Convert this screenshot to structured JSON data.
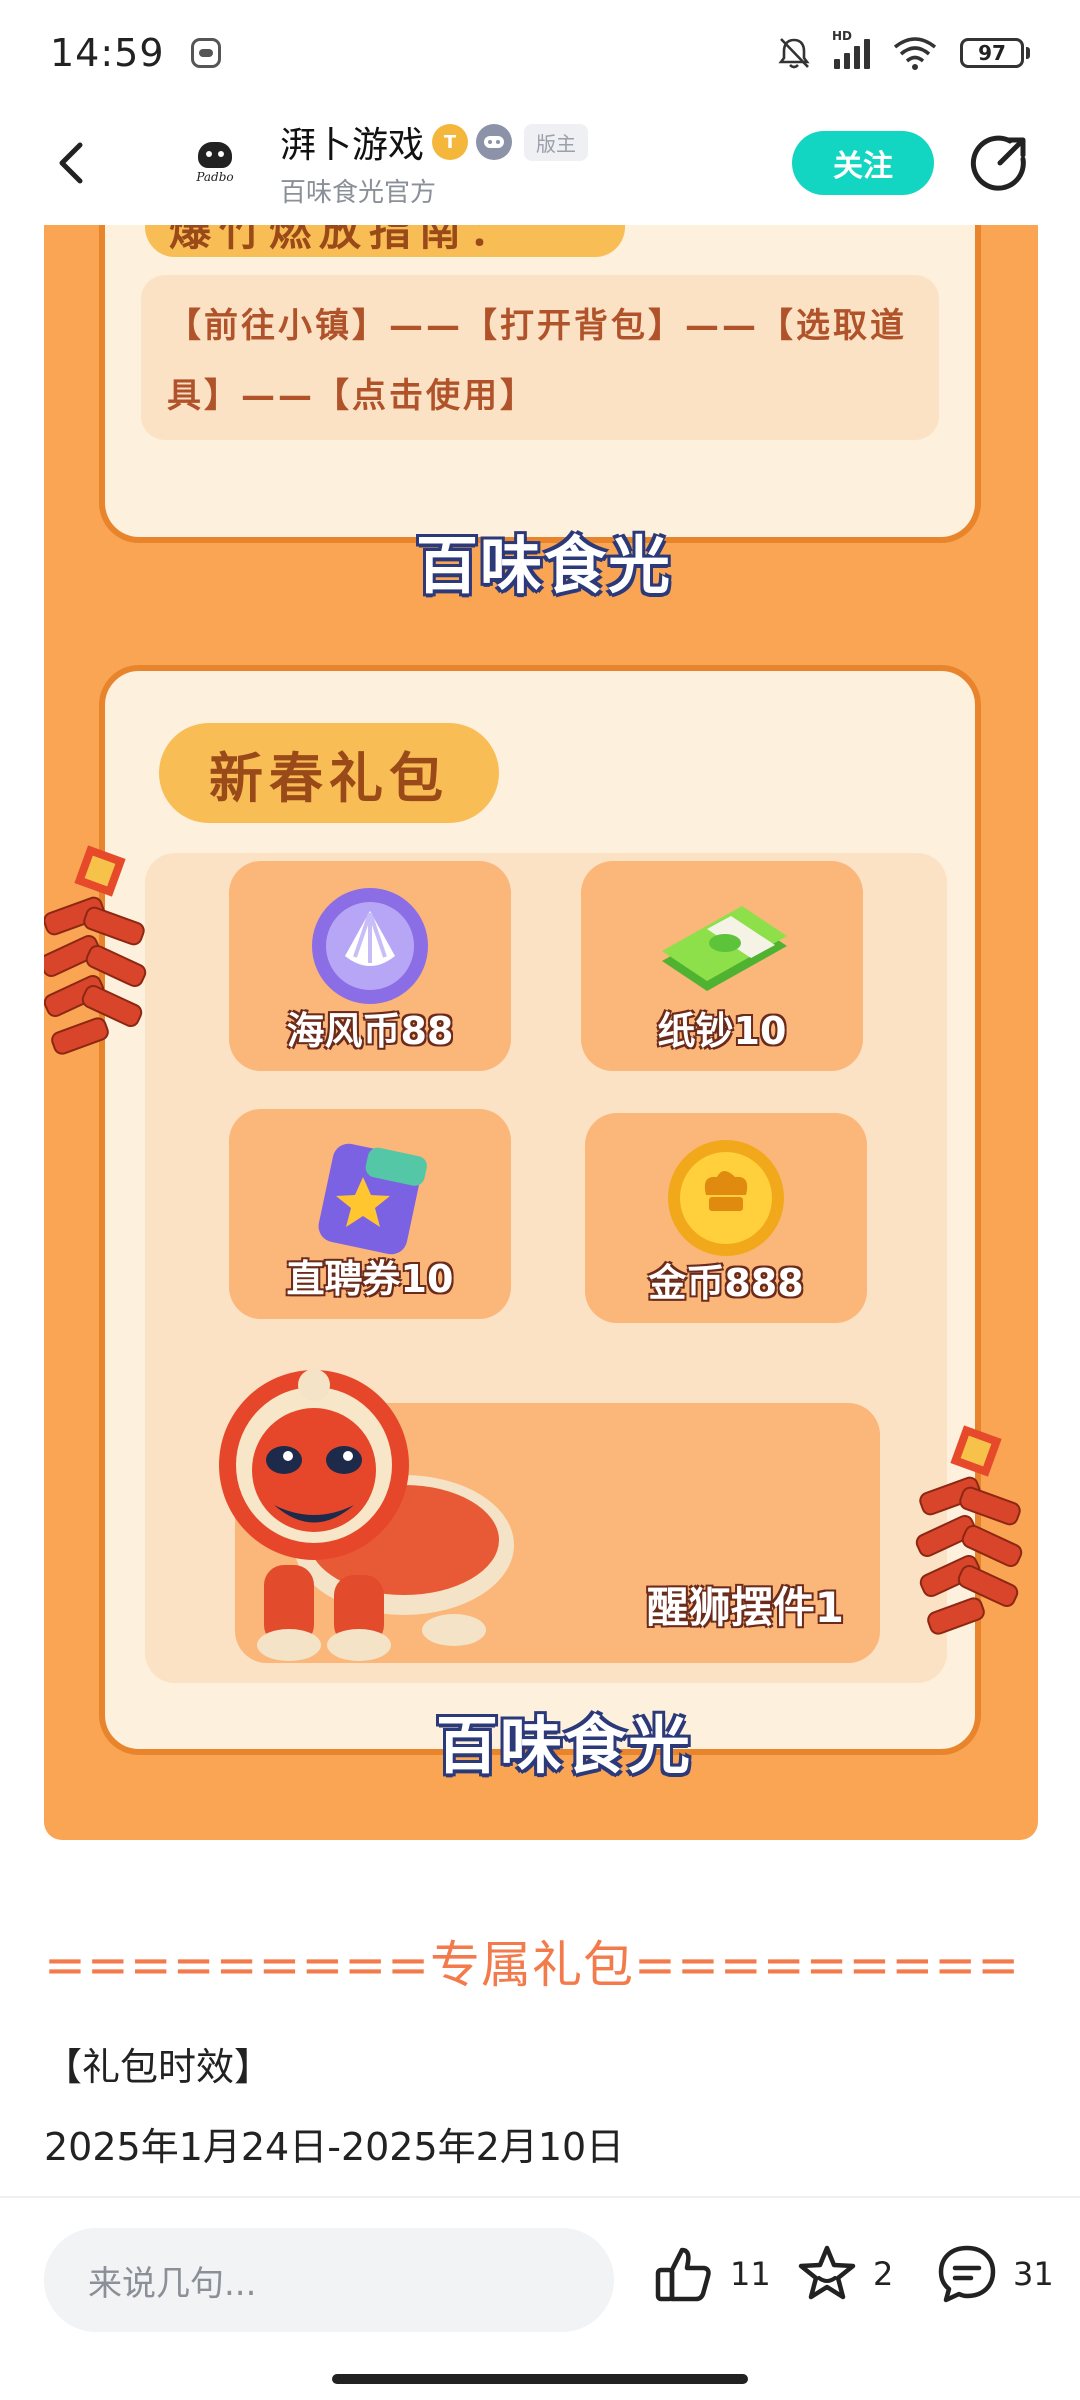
{
  "status_bar": {
    "time": "14:59",
    "battery": "97",
    "network_label": "HD",
    "icons": [
      "app-notification-icon",
      "mute-icon",
      "signal-icon",
      "wifi-icon",
      "battery-icon"
    ]
  },
  "header": {
    "channel_name": "湃卜游戏",
    "subtitle": "百味食光官方",
    "badge_gold": "T",
    "moderator_badge": "版主",
    "avatar_text": "Padbo",
    "follow_label": "关注",
    "icons": [
      "back-icon",
      "share-icon"
    ]
  },
  "banner": {
    "guide_heading": "爆竹燃放指南：",
    "guide_text": "【前往小镇】——【打开背包】——【选取道具】——【点击使用】",
    "logo_text": "百味食光",
    "gift_heading": "新春礼包",
    "items": [
      {
        "label": "海风币88",
        "icon": "seashell-coin-icon"
      },
      {
        "label": "纸钞10",
        "icon": "banknote-stack-icon"
      },
      {
        "label": "直聘券10",
        "icon": "star-ticket-icon"
      },
      {
        "label": "金币888",
        "icon": "gold-coin-icon"
      }
    ],
    "lion_label": "醒狮摆件1",
    "colors": {
      "background": "#f9a553",
      "card": "#fdf0dc",
      "accent": "#f9bd55"
    }
  },
  "post": {
    "section_title": "=========专属礼包=========",
    "validity_label": "【礼包时效】",
    "validity_value": "2025年1月24日-2025年2月10日"
  },
  "bottom_bar": {
    "comment_placeholder": "来说几句...",
    "like_count": "11",
    "favorite_count": "2",
    "comment_count": "31"
  }
}
